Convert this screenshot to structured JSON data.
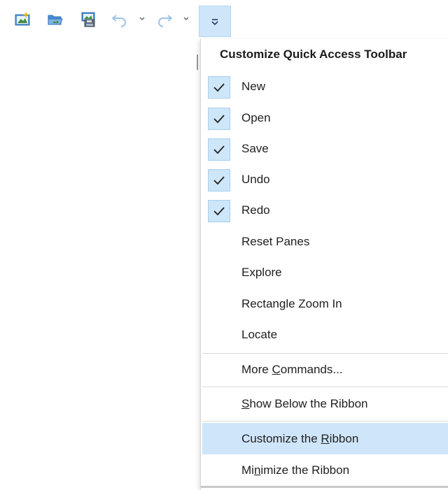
{
  "toolbar": {
    "icons": [
      "new-project-icon",
      "open-project-icon",
      "save-project-icon",
      "undo-icon",
      "redo-icon",
      "customize-toolbar-icon"
    ]
  },
  "menu": {
    "title": "Customize Quick Access Toolbar",
    "checked_items": [
      {
        "label": "New",
        "checked": true
      },
      {
        "label": "Open",
        "checked": true
      },
      {
        "label": "Save",
        "checked": true
      },
      {
        "label": "Undo",
        "checked": true
      },
      {
        "label": "Redo",
        "checked": true
      }
    ],
    "unchecked_items": [
      {
        "label": "Reset Panes"
      },
      {
        "label": "Explore"
      },
      {
        "label": "Rectangle Zoom In"
      },
      {
        "label": "Locate"
      }
    ],
    "more_commands": {
      "pre": "More ",
      "key": "C",
      "post": "ommands..."
    },
    "show_below": {
      "pre": "",
      "key": "S",
      "post": "how Below the Ribbon"
    },
    "customize_ribbon": {
      "pre": "Customize the ",
      "key": "R",
      "post": "ibbon"
    },
    "minimize_ribbon": {
      "pre": "Mi",
      "key": "n",
      "post": "imize the Ribbon"
    }
  },
  "colors": {
    "accent": "#cfe6fa",
    "check_bg": "#cde6f8",
    "icon_blue": "#3a7bd5"
  }
}
